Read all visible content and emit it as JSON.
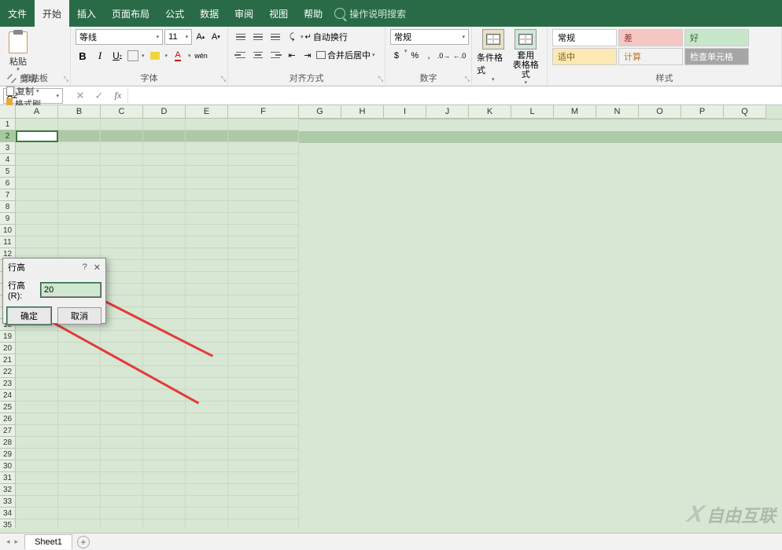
{
  "menu": {
    "items": [
      "文件",
      "开始",
      "插入",
      "页面布局",
      "公式",
      "数据",
      "审阅",
      "视图",
      "帮助"
    ],
    "active": "开始",
    "search_placeholder": "操作说明搜索"
  },
  "ribbon": {
    "clipboard": {
      "label": "剪贴板",
      "paste": "粘贴",
      "cut": "剪切",
      "copy": "复制",
      "format_painter": "格式刷"
    },
    "font": {
      "label": "字体",
      "name": "等线",
      "size": "11"
    },
    "align": {
      "label": "对齐方式",
      "wrap": "自动换行",
      "merge": "合并后居中"
    },
    "number": {
      "label": "数字",
      "format": "常规",
      "percent": "%",
      "comma": ","
    },
    "format": {
      "cond": "条件格式",
      "table": "套用\n表格格式"
    },
    "styles": {
      "label": "样式",
      "normal": "常规",
      "bad": "差",
      "good": "好",
      "neutral": "适中",
      "calc": "计算",
      "check": "检查单元格"
    }
  },
  "name_box": "A2",
  "columns": {
    "headers": [
      "A",
      "B",
      "C",
      "D",
      "E",
      "F",
      "G",
      "H",
      "I",
      "J",
      "K",
      "L",
      "M",
      "N",
      "O",
      "P",
      "Q"
    ],
    "widths": [
      54,
      54,
      54,
      54,
      54,
      90,
      54,
      54,
      54,
      54,
      54,
      54,
      54,
      54,
      54,
      54,
      54
    ]
  },
  "row_count_visible": 35,
  "selected_row": 2,
  "filled_cols": 6,
  "dialog": {
    "title": "行高",
    "field_label": "行高(R):",
    "value": "20",
    "ok": "确定",
    "cancel": "取消",
    "help": "?",
    "close": "✕"
  },
  "sheet": {
    "name": "Sheet1"
  },
  "watermark": "自由互联"
}
